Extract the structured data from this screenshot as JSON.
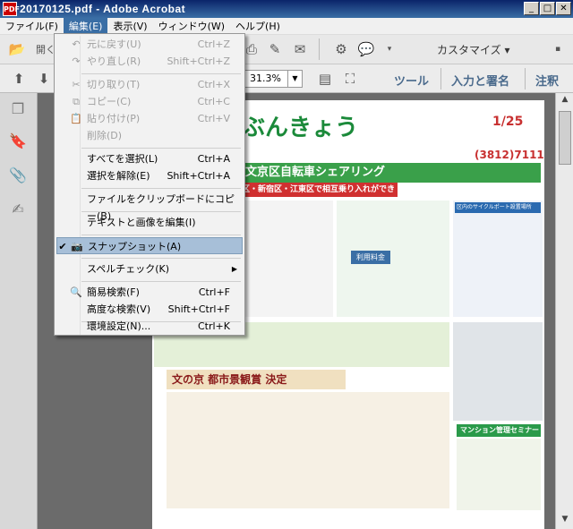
{
  "window": {
    "title": "20170125.pdf - Adobe Acrobat",
    "app_icon": "pdf-icon"
  },
  "menubar": [
    {
      "label": "ファイル(F)"
    },
    {
      "label": "編集(E)"
    },
    {
      "label": "表示(V)"
    },
    {
      "label": "ウィンドウ(W)"
    },
    {
      "label": "ヘルプ(H)"
    }
  ],
  "toolbar": {
    "customize_label": "カスタマイズ",
    "zoom_value": "31.3%",
    "tools_label": "ツール",
    "sign_label": "入力と署名",
    "comment_label": "注釈",
    "open_label": "開く"
  },
  "edit_menu": {
    "items": [
      {
        "label": "元に戻す(U)",
        "shortcut": "Ctrl+Z"
      },
      {
        "label": "やり直し(R)",
        "shortcut": "Shift+Ctrl+Z"
      },
      {
        "label": "切り取り(T)",
        "shortcut": "Ctrl+X"
      },
      {
        "label": "コピー(C)",
        "shortcut": "Ctrl+C"
      },
      {
        "label": "貼り付け(P)",
        "shortcut": "Ctrl+V"
      },
      {
        "label": "削除(D)",
        "shortcut": ""
      },
      {
        "label": "すべてを選択(L)",
        "shortcut": "Ctrl+A"
      },
      {
        "label": "選択を解除(E)",
        "shortcut": "Shift+Ctrl+A"
      },
      {
        "label": "ファイルをクリップボードにコピー(B)",
        "shortcut": ""
      },
      {
        "label": "テキストと画像を編集(I)",
        "shortcut": ""
      },
      {
        "label": "スナップショット(A)",
        "shortcut": ""
      },
      {
        "label": "スペルチェック(K)",
        "shortcut": ""
      },
      {
        "label": "簡易検索(F)",
        "shortcut": "Ctrl+F"
      },
      {
        "label": "高度な検索(V)",
        "shortcut": "Shift+Ctrl+F"
      },
      {
        "label": "環境設定(N)...",
        "shortcut": "Ctrl+K"
      }
    ]
  },
  "document": {
    "title": "ぶんきょう",
    "date": "1/25",
    "headline": "文京区自転車シェアリング",
    "subhead": "区・新宿区・江東区で相互乗り入れができます",
    "phone": "(3812)7111",
    "section_title": "文の京 都市景観賞 決定",
    "mansion_title": "マンション管理セミナー",
    "usage_fee": "利用料金",
    "port_list_title": "区内のサイクルポート設置場所"
  },
  "colors": {
    "title_active": "#0a246a",
    "menu_highlight": "#a7bfd8",
    "newsletter_green": "#1b8a3a",
    "newsletter_red": "#c83030"
  }
}
